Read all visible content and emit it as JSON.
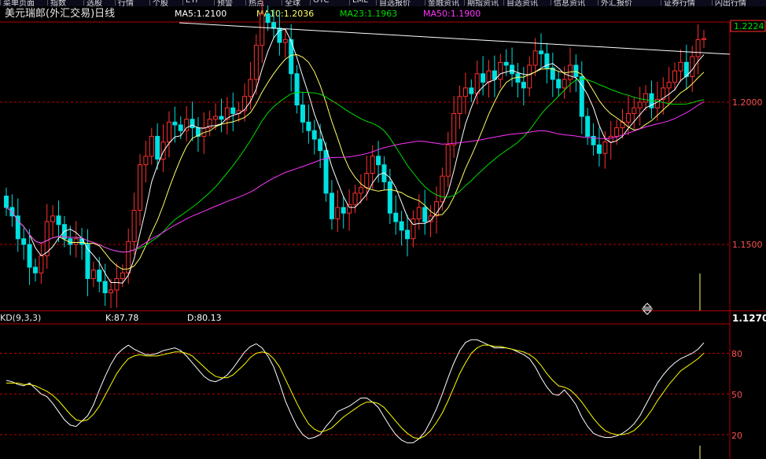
{
  "top_tabs": [
    {
      "label": "菜单页面",
      "x": 0
    },
    {
      "label": "指数",
      "x": 60
    },
    {
      "label": "选股",
      "x": 106
    },
    {
      "label": "行情",
      "x": 146
    },
    {
      "label": "个股",
      "x": 190
    },
    {
      "label": "ETF",
      "x": 232
    },
    {
      "label": "预警",
      "x": 272
    },
    {
      "label": "热点",
      "x": 312
    },
    {
      "label": "全球",
      "x": 358
    },
    {
      "label": "OTC",
      "x": 394
    },
    {
      "label": "LME",
      "x": 444
    },
    {
      "label": "自选报价",
      "x": 478
    },
    {
      "label": "金融资讯",
      "x": 540
    },
    {
      "label": "期指资讯",
      "x": 590
    },
    {
      "label": "自选资讯",
      "x": 640
    },
    {
      "label": "信息资讯",
      "x": 700
    },
    {
      "label": "外汇报价",
      "x": 760
    },
    {
      "label": "证券行情",
      "x": 840
    },
    {
      "label": "闪出行情",
      "x": 905
    }
  ],
  "header": {
    "instrument": "美元瑞郎(外汇交易)日线",
    "ma5": "MA5:1.2100",
    "ma10": "MA10:1.2036",
    "ma23": "MA23:1.1963",
    "ma50": "MA50:1.1900"
  },
  "kd_header": {
    "name": "KD(9,3,3)",
    "k": "K:87.78",
    "d": "D:80.13"
  },
  "price_axis": {
    "last_price": "1.2224",
    "ticks": [
      "1.2000",
      "1.1500"
    ],
    "bottom_label": "1.1270"
  },
  "kd_axis": {
    "ticks": [
      "80",
      "50",
      "20"
    ]
  },
  "colors": {
    "up": "#ff3030",
    "down": "#00e0e0",
    "ma5": "#ffffff",
    "ma10": "#ffff66",
    "ma23": "#00dd00",
    "ma50": "#ff33ff",
    "k_line": "#ffffff",
    "d_line": "#ffff00",
    "grid": "#c00000"
  },
  "chart_data": [
    {
      "type": "candlestick",
      "title": "美元瑞郎(外汇交易)日线",
      "ylim": [
        1.127,
        1.24
      ],
      "gridlines": [
        1.2,
        1.15
      ],
      "last_value": 1.2224,
      "close": [
        1.163,
        1.16,
        1.152,
        1.15,
        1.142,
        1.14,
        1.146,
        1.158,
        1.16,
        1.157,
        1.152,
        1.15,
        1.152,
        1.15,
        1.138,
        1.141,
        1.137,
        1.133,
        1.134,
        1.138,
        1.14,
        1.151,
        1.162,
        1.178,
        1.181,
        1.188,
        1.18,
        1.186,
        1.193,
        1.192,
        1.19,
        1.194,
        1.191,
        1.188,
        1.191,
        1.194,
        1.195,
        1.194,
        1.198,
        1.196,
        1.197,
        1.202,
        1.208,
        1.22,
        1.231,
        1.228,
        1.226,
        1.221,
        1.222,
        1.21,
        1.199,
        1.193,
        1.19,
        1.187,
        1.183,
        1.168,
        1.159,
        1.163,
        1.161,
        1.164,
        1.168,
        1.17,
        1.175,
        1.181,
        1.178,
        1.172,
        1.161,
        1.158,
        1.155,
        1.152,
        1.159,
        1.163,
        1.158,
        1.16,
        1.165,
        1.174,
        1.185,
        1.196,
        1.202,
        1.205,
        1.203,
        1.21,
        1.207,
        1.211,
        1.208,
        1.214,
        1.213,
        1.21,
        1.207,
        1.205,
        1.213,
        1.218,
        1.217,
        1.212,
        1.208,
        1.205,
        1.208,
        1.213,
        1.209,
        1.195,
        1.188,
        1.185,
        1.182,
        1.186,
        1.188,
        1.191,
        1.193,
        1.196,
        1.198,
        1.2,
        1.203,
        1.198,
        1.201,
        1.205,
        1.207,
        1.211,
        1.214,
        1.209,
        1.216,
        1.222,
        1.2224
      ]
    },
    {
      "type": "line",
      "title": "KD(9,3,3)",
      "ylim": [
        10,
        100
      ],
      "gridlines": [
        80,
        50,
        20
      ],
      "series": [
        {
          "name": "K",
          "values": [
            60,
            59,
            57,
            56,
            58,
            54,
            50,
            48,
            43,
            37,
            31,
            27,
            26,
            30,
            34,
            42,
            53,
            63,
            72,
            79,
            83,
            86,
            83,
            81,
            79,
            79,
            80,
            82,
            83,
            84,
            82,
            78,
            73,
            68,
            63,
            60,
            59,
            61,
            64,
            69,
            75,
            81,
            85,
            87,
            84,
            78,
            70,
            58,
            45,
            35,
            26,
            20,
            17,
            18,
            20,
            26,
            31,
            37,
            39,
            41,
            44,
            47,
            47,
            44,
            40,
            33,
            26,
            20,
            16,
            14,
            14,
            17,
            22,
            30,
            39,
            50,
            62,
            73,
            82,
            88,
            90,
            90,
            88,
            86,
            84,
            84,
            84,
            83,
            81,
            79,
            76,
            70,
            62,
            55,
            50,
            49,
            53,
            48,
            42,
            33,
            26,
            21,
            19,
            18,
            18,
            19,
            21,
            24,
            28,
            34,
            42,
            50,
            58,
            64,
            69,
            73,
            76,
            78,
            80,
            83,
            87.78
          ]
        },
        {
          "name": "D",
          "values": [
            58,
            58,
            58,
            57,
            57,
            56,
            54,
            52,
            49,
            45,
            40,
            35,
            31,
            30,
            31,
            35,
            41,
            49,
            57,
            65,
            71,
            76,
            78,
            79,
            78,
            78,
            78,
            79,
            80,
            81,
            81,
            80,
            78,
            74,
            70,
            66,
            63,
            62,
            62,
            64,
            68,
            72,
            77,
            80,
            81,
            80,
            76,
            70,
            61,
            52,
            43,
            35,
            28,
            24,
            22,
            23,
            25,
            29,
            33,
            36,
            39,
            42,
            44,
            44,
            43,
            40,
            35,
            30,
            25,
            21,
            18,
            17,
            19,
            23,
            29,
            36,
            45,
            55,
            65,
            73,
            80,
            84,
            86,
            86,
            85,
            85,
            84,
            83,
            82,
            81,
            79,
            76,
            71,
            65,
            60,
            56,
            55,
            53,
            49,
            44,
            38,
            32,
            27,
            23,
            21,
            20,
            20,
            21,
            23,
            27,
            32,
            38,
            45,
            51,
            57,
            62,
            67,
            70,
            73,
            76,
            80.13
          ]
        }
      ]
    }
  ]
}
